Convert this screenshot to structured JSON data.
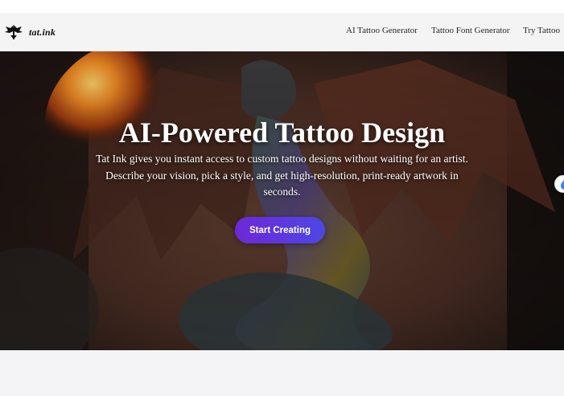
{
  "header": {
    "logo_icon": "winged-emblem-icon",
    "logo_text": "tat.ink",
    "nav": [
      {
        "label": "AI Tattoo Generator"
      },
      {
        "label": "Tattoo Font Generator"
      },
      {
        "label": "Try Tattoo"
      }
    ]
  },
  "hero": {
    "background": "dragon-tattoo-image",
    "title": "AI-Powered Tattoo Design",
    "description": "Tat Ink gives you instant access to custom tattoo designs without waiting for an artist. Describe your vision, pick a style, and get high-resolution, print-ready artwork in seconds.",
    "cta_label": "Start Creating",
    "cta_colors": [
      "#6d28d9",
      "#4f46e5"
    ]
  },
  "side_widget": {
    "icon": "droplet-icon",
    "color": "#3b82f6"
  }
}
